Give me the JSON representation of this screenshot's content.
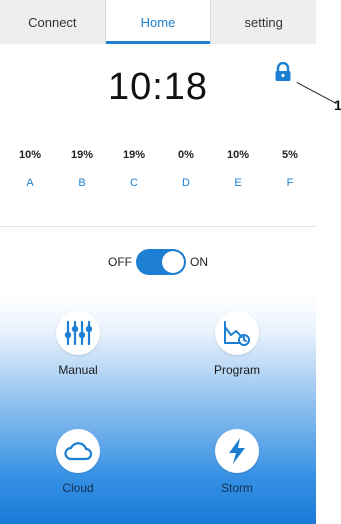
{
  "tabs": [
    {
      "label": "Connect"
    },
    {
      "label": "Home"
    },
    {
      "label": "setting"
    }
  ],
  "time": "10:18",
  "callout": "1",
  "channels": [
    {
      "percent": "10%",
      "letter": "A"
    },
    {
      "percent": "19%",
      "letter": "B"
    },
    {
      "percent": "19%",
      "letter": "C"
    },
    {
      "percent": "0%",
      "letter": "D"
    },
    {
      "percent": "10%",
      "letter": "E"
    },
    {
      "percent": "5%",
      "letter": "F"
    }
  ],
  "power": {
    "off_label": "OFF",
    "on_label": "ON",
    "state": "on"
  },
  "modes": [
    {
      "label": "Manual",
      "icon": "sliders-icon"
    },
    {
      "label": "Program",
      "icon": "program-chart-icon"
    },
    {
      "label": "Cloud",
      "icon": "cloud-icon"
    },
    {
      "label": "Storm",
      "icon": "lightning-icon"
    }
  ],
  "colors": {
    "accent": "#1d7fd3",
    "panel_bottom": "#1b7ad8"
  }
}
